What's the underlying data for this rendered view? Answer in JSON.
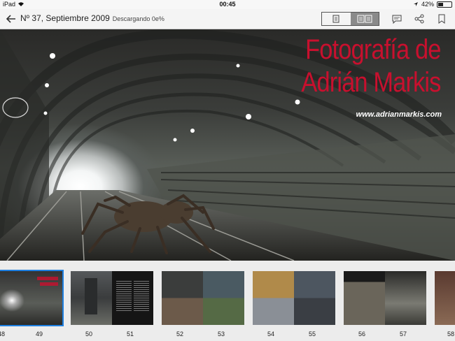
{
  "status": {
    "device": "iPad",
    "time": "00:45",
    "battery_text": "42%",
    "battery_level": 0.42
  },
  "navbar": {
    "title": "Nº 37, Septiembre 2009",
    "subtitle": "Descargando 0e%",
    "view_mode_selected": "double-page"
  },
  "hero": {
    "title_line1": "Fotografía de",
    "title_line2": "Adrián Markis",
    "url": "www.adrianmarkis.com"
  },
  "thumbnails": {
    "selected_page": "49",
    "pages": [
      "48",
      "49",
      "50",
      "51",
      "52",
      "53",
      "54",
      "55",
      "56",
      "57",
      "58"
    ]
  },
  "colors": {
    "accent": "#c8102e",
    "selection": "#1e7fe0"
  }
}
